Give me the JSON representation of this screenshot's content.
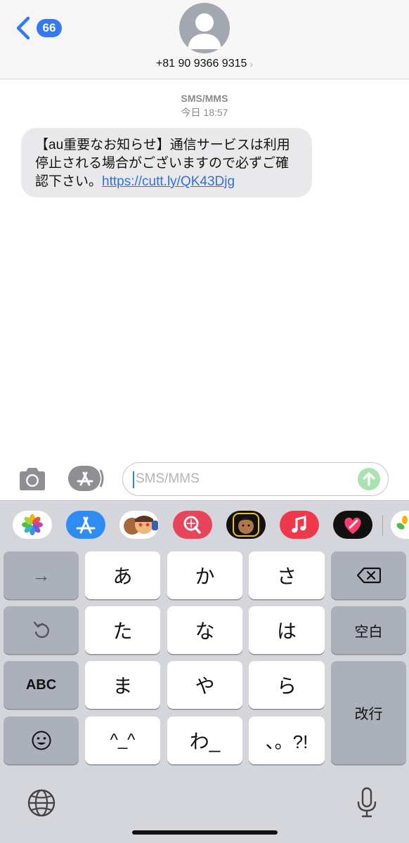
{
  "header": {
    "back_badge": "66",
    "contact": "+81 90 9366 9315"
  },
  "conversation": {
    "service": "SMS/MMS",
    "timestamp": "今日 18:57",
    "message": {
      "text": "【au重要なお知らせ】通信サービスは利用停止される場合がございますので必ずご確認下さい。",
      "link": "https://cutt.ly/QK43Djg"
    }
  },
  "composer": {
    "placeholder": "SMS/MMS",
    "send_color": "#a8e3b0"
  },
  "app_strip": {
    "apps": [
      "photos-app",
      "app-store-app",
      "memoji-stickers-app",
      "image-search-app",
      "memoji-app",
      "music-app",
      "digital-touch-app",
      "photos-app"
    ]
  },
  "keyboard": {
    "rows": [
      [
        "→",
        "あ",
        "か",
        "さ",
        "⌫"
      ],
      [
        "↺",
        "た",
        "な",
        "は",
        "空白"
      ],
      [
        "ABC",
        "ま",
        "や",
        "ら",
        "改行"
      ],
      [
        "☺",
        "^_^",
        "わ_",
        "、。?!"
      ]
    ]
  },
  "colors": {
    "accent": "#3478f6",
    "bubble": "#e9e9eb",
    "keyboard_bg": "#d5d6db"
  }
}
